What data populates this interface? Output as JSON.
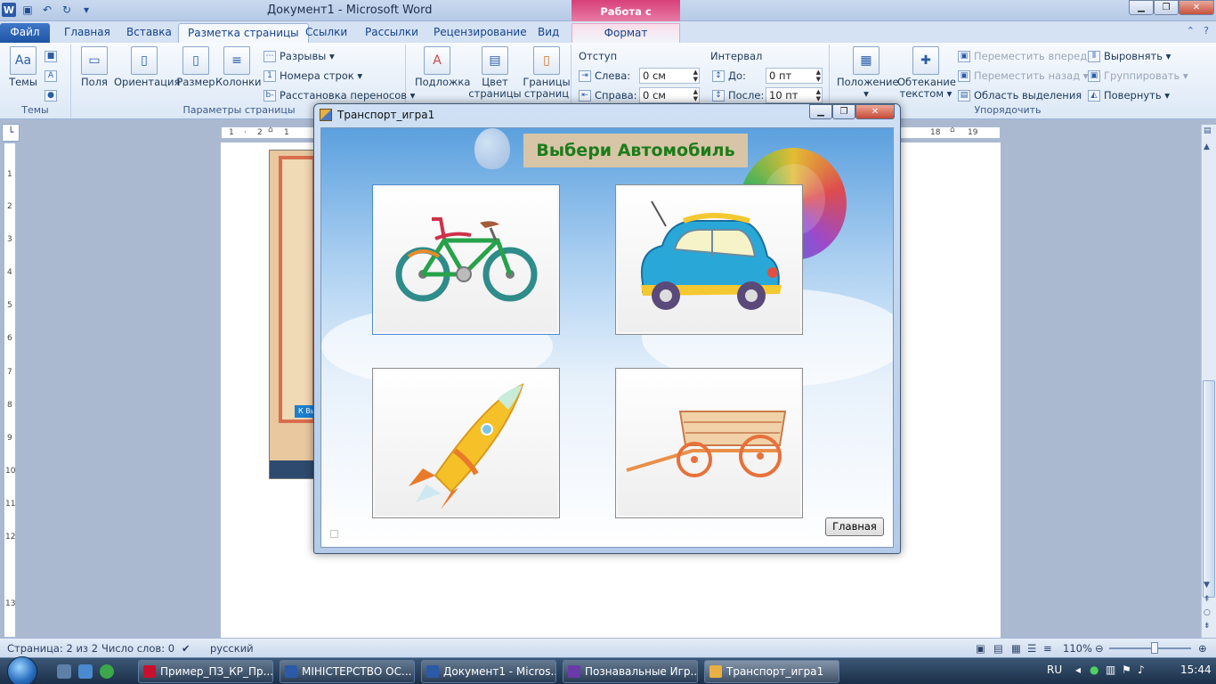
{
  "window": {
    "title": "Документ1 - Microsoft Word",
    "context_tab_header": "Работа с рисунками"
  },
  "tabs": [
    {
      "label": "Файл"
    },
    {
      "label": "Главная"
    },
    {
      "label": "Вставка"
    },
    {
      "label": "Разметка страницы"
    },
    {
      "label": "Ссылки"
    },
    {
      "label": "Рассылки"
    },
    {
      "label": "Рецензирование"
    },
    {
      "label": "Вид"
    },
    {
      "label": "Формат"
    }
  ],
  "ribbon": {
    "themes": {
      "button": "Темы",
      "group": "Темы"
    },
    "page_setup": {
      "group": "Параметры страницы",
      "fields": "Поля",
      "orientation": "Ориентация",
      "size": "Размер",
      "columns": "Колонки",
      "breaks": "Разрывы",
      "line_numbers": "Номера строк",
      "hyphenation": "Расстановка переносов"
    },
    "background": {
      "watermark": "Подложка",
      "page_color_1": "Цвет",
      "page_color_2": "страницы",
      "borders_1": "Границы",
      "borders_2": "страниц"
    },
    "paragraph": {
      "indent_title": "Отступ",
      "left_label": "Слева:",
      "left_value": "0 см",
      "right_label": "Справа:",
      "right_value": "0 см",
      "spacing_title": "Интервал",
      "before_label": "До:",
      "before_value": "0 пт",
      "after_label": "После:",
      "after_value": "10 пт"
    },
    "arrange": {
      "group": "Упорядочить",
      "position": "Положение",
      "wrap_1": "Обтекание",
      "wrap_2": "текстом",
      "bring_forward": "Переместить вперед",
      "send_backward": "Переместить назад",
      "selection_pane": "Область выделения",
      "align": "Выровнять",
      "group_btn": "Группировать",
      "rotate": "Повернуть"
    }
  },
  "ruler": {
    "h_left": [
      "1",
      "2",
      "1"
    ],
    "h_right": [
      "18",
      "19"
    ],
    "v_numbers": [
      "1",
      "2",
      "3",
      "4",
      "5",
      "6",
      "7",
      "8",
      "9",
      "10",
      "11",
      "12",
      "13"
    ]
  },
  "inner_screenshot": {
    "button": "К Вы"
  },
  "app": {
    "title": "Транспорт_игра1",
    "banner": "Выбери Автомобиль",
    "items": [
      {
        "name": "bicycle"
      },
      {
        "name": "car"
      },
      {
        "name": "rocket"
      },
      {
        "name": "cart"
      }
    ],
    "main_button": "Главная"
  },
  "status": {
    "page": "Страница: 2 из 2",
    "words": "Число слов: 0",
    "language": "русский",
    "zoom": "110%"
  },
  "taskbar": {
    "items": [
      {
        "label": "Пример_ПЗ_КР_Пр...",
        "icon_color": "#c8102e"
      },
      {
        "label": "МІНІСТЕРСТВО ОС...",
        "icon_color": "#2b5aa8"
      },
      {
        "label": "Документ1 - Micros...",
        "icon_color": "#2b5aa8"
      },
      {
        "label": "Познавальные Игр...",
        "icon_color": "#6a3aa8"
      },
      {
        "label": "Транспорт_игра1",
        "icon_color": "#e8b040"
      }
    ],
    "lang": "RU",
    "time": "15:44"
  }
}
